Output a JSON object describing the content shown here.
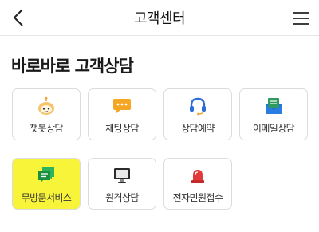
{
  "header": {
    "title": "고객센터",
    "back_icon": "chevron-left-icon",
    "menu_icon": "hamburger-menu-icon"
  },
  "section": {
    "title": "바로바로 고객상담"
  },
  "tiles": [
    {
      "label": "챗봇상담",
      "icon": "chatbot-icon",
      "color": "#f0a43a"
    },
    {
      "label": "채팅상담",
      "icon": "chat-bubble-icon",
      "color": "#f5a623"
    },
    {
      "label": "상담예약",
      "icon": "headset-icon",
      "color": "#2b6fd6"
    },
    {
      "label": "이메일상담",
      "icon": "email-icon",
      "color": "#2e9a5d"
    },
    {
      "label": "무방문서비스",
      "icon": "message-icon",
      "color": "#1fa34a",
      "highlighted": true
    },
    {
      "label": "원격상담",
      "icon": "monitor-icon",
      "color": "#222222"
    },
    {
      "label": "전자민원접수",
      "icon": "siren-icon",
      "color": "#e03a3a"
    }
  ],
  "colors": {
    "highlight": "#f8f43a",
    "tile_border": "#dcdcdc"
  }
}
